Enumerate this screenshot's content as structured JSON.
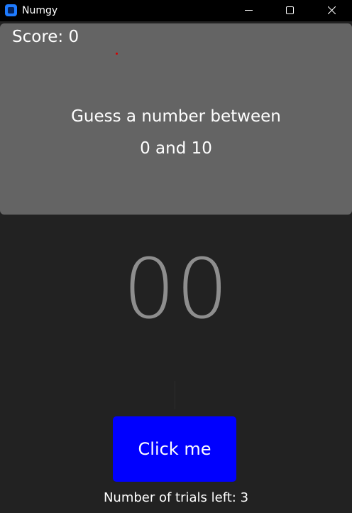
{
  "window": {
    "title": "Numgy",
    "icon": "app-icon",
    "controls": [
      "minimize-icon",
      "maximize-icon",
      "close-icon"
    ]
  },
  "game": {
    "score_text": "Score: 0",
    "prompt_line1": "Guess a number between",
    "prompt_line2": "0 and 10",
    "number_display": "00",
    "button_label": "Click me",
    "trials_text": "Number of trials left: 3"
  },
  "colors": {
    "background": "#222222",
    "panel": "#646464",
    "button": "#0000ff",
    "number": "#8e8e8e",
    "titlebar": "#000000"
  }
}
